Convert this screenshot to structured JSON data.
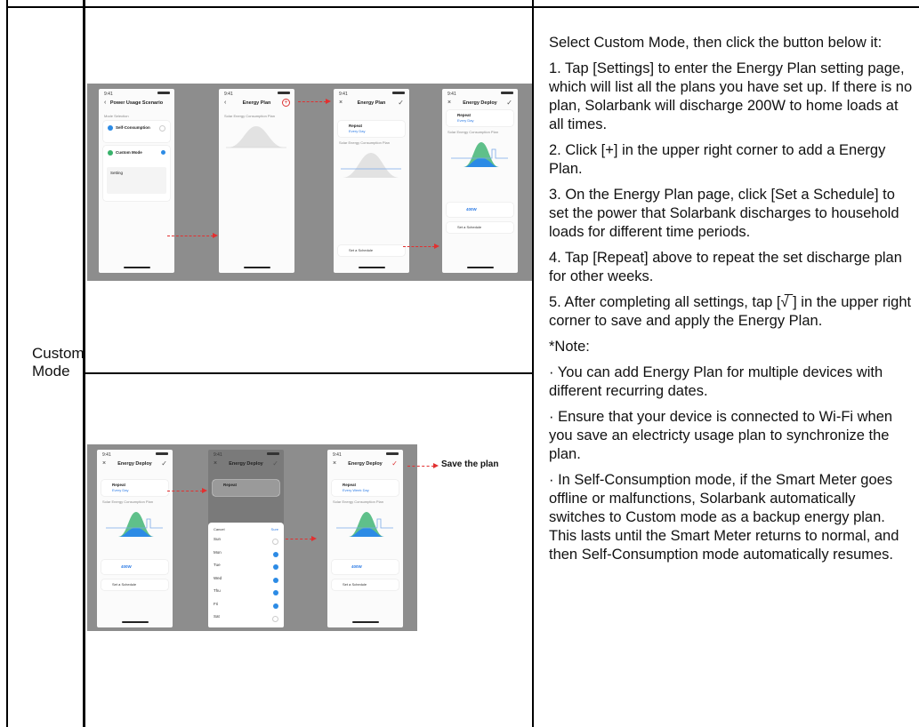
{
  "section_label": "Custom Mode",
  "instructions": {
    "intro": "Select Custom Mode, then click the button below it:",
    "step1": "1. Tap [Settings] to enter the Energy Plan setting page, which will list all the plans you have set up. If there is no plan, Solarbank will discharge 200W to home loads at all times.",
    "step2": "2. Click [+] in the upper right corner to add a Energy Plan.",
    "step3": "3. On the Energy Plan page, click [Set a Schedule] to set the power that Solarbank discharges to household loads for different time periods.",
    "step4": "4. Tap [Repeat] above to repeat the set discharge plan for other weeks.",
    "step5": "5. After completing all settings, tap [√̅ ] in the upper right corner to save and apply the Energy Plan.",
    "note_title": "*Note:",
    "note1": "· You can add Energy Plan for multiple devices with different recurring dates.",
    "note2": "· Ensure that your device is connected to Wi-Fi when you save an electricty usage plan to synchronize the plan.",
    "note3": "· In Self-Consumption mode, if the Smart Meter goes offline or malfunctions, Solarbank automatically switches to Custom mode as a backup energy plan. This lasts until the Smart Meter returns to normal, and then Self-Consumption mode automatically resumes."
  },
  "top_screens": {
    "time": "9:41",
    "s1": {
      "title": "Power Usage Scenario",
      "section": "Mode Selection",
      "opt1": "Self-Consumption",
      "opt2": "Custom Mode",
      "setting": "Setting"
    },
    "s2": {
      "title": "Energy Plan",
      "chart_title": "Solar Energy Consumption Plan"
    },
    "s3": {
      "title": "Energy Plan",
      "repeat": "Repeat",
      "repeat_value": "Every Day",
      "chart_title": "Solar Energy Consumption Plan",
      "schedule": "Set a Schedule"
    },
    "s4": {
      "title": "Energy Deploy",
      "repeat": "Repeat",
      "repeat_value": "Every Day",
      "chart_title": "Solar Energy Consumption Plan",
      "power": "400W",
      "schedule": "Set a Schedule"
    }
  },
  "bottom_screens": {
    "time": "9:41",
    "s1": {
      "title": "Energy Deploy",
      "repeat": "Repeat",
      "repeat_value": "Every Day",
      "chart_title": "Solar Energy Consumption Plan",
      "power": "400W",
      "schedule": "Set a Schedule"
    },
    "s2": {
      "title": "Energy Deploy",
      "repeat": "Repeat",
      "cancel": "Cancel",
      "confirm": "Sure",
      "days": [
        "Sun",
        "Mon",
        "Tue",
        "Wed",
        "Thu",
        "Fri",
        "Sat"
      ],
      "checked": [
        false,
        true,
        true,
        true,
        true,
        true,
        false
      ]
    },
    "s3": {
      "title": "Energy Deploy",
      "repeat": "Repeat",
      "repeat_value": "Every Week Day",
      "chart_title": "Solar Energy Consumption Plan",
      "power": "400W",
      "schedule": "Set a Schedule"
    },
    "save_label": "Save the plan"
  },
  "colors": {
    "accent_blue": "#2c7be5",
    "accent_green": "#38b26b",
    "arrow_red": "#e23030",
    "screenshot_bg": "#8d8d8d"
  }
}
